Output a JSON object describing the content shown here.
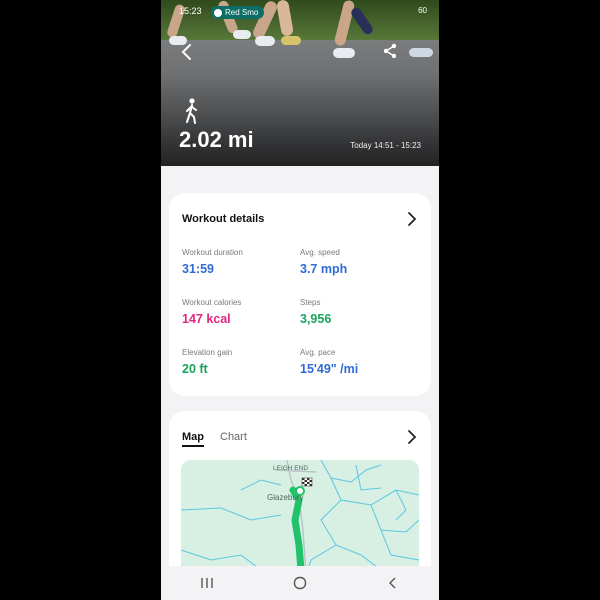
{
  "status_bar": {
    "time": "15:23",
    "media_pill": "Red Smo",
    "right_label": "60"
  },
  "hero": {
    "distance": "2.02 mi",
    "time_range": "Today 14:51 - 15:23",
    "icons": [
      "back-icon",
      "share-icon",
      "walk-icon"
    ]
  },
  "workout": {
    "title": "Workout details",
    "metrics": [
      {
        "label": "Workout duration",
        "value": "31:59",
        "color": "#2f6bd6"
      },
      {
        "label": "Avg. speed",
        "value": "3.7 mph",
        "color": "#2f6bd6"
      },
      {
        "label": "Workout calories",
        "value": "147 kcal",
        "color": "#e0287e"
      },
      {
        "label": "Steps",
        "value": "3,956",
        "color": "#1aa35a"
      },
      {
        "label": "Elevation gain",
        "value": "20 ft",
        "color": "#1aa35a"
      },
      {
        "label": "Avg. pace",
        "value": "15'49\" /mi",
        "color": "#2f6bd6"
      }
    ]
  },
  "map_card": {
    "tabs": [
      {
        "label": "Map",
        "active": true
      },
      {
        "label": "Chart",
        "active": false
      }
    ],
    "map_labels": {
      "place1": "LEIGH END",
      "place2": "Glazebury"
    }
  },
  "nav": {
    "icons": [
      "recents-icon",
      "home-icon",
      "back-nav-icon"
    ]
  },
  "colors": {
    "accent_blue": "#2f6bd6",
    "accent_pink": "#e0287e",
    "accent_green": "#1aa35a",
    "route": "#22c26a"
  }
}
